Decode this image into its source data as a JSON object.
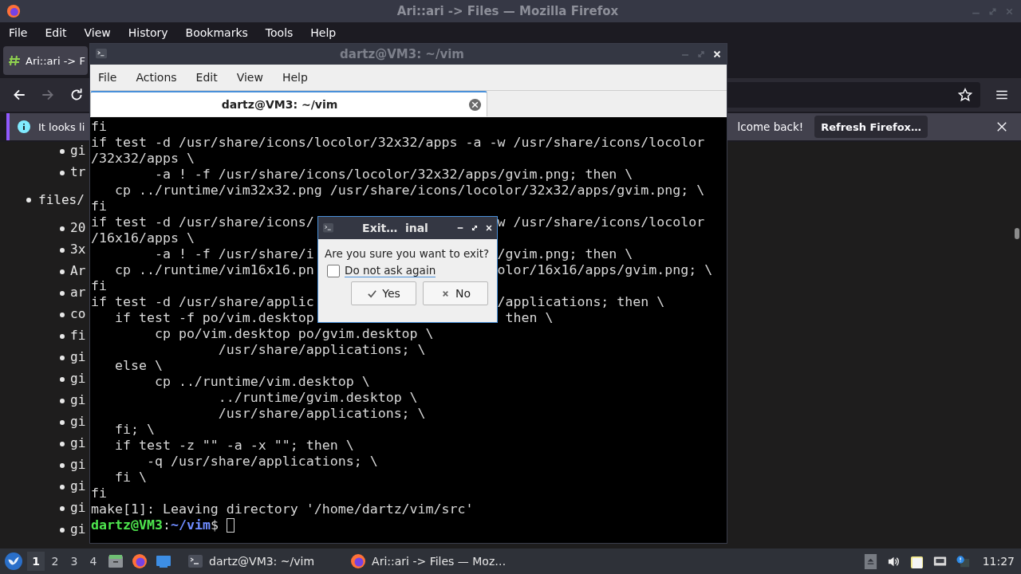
{
  "firefox": {
    "title": "Ari::ari -> Files — Mozilla Firefox",
    "menu": [
      "File",
      "Edit",
      "View",
      "History",
      "Bookmarks",
      "Tools",
      "Help"
    ],
    "tab": {
      "label": "Ari::ari -> F"
    },
    "notification": {
      "text_left": "It looks li",
      "text_right": "lcome back!",
      "button": "Refresh Firefox…"
    },
    "page_list": [
      {
        "label": "gi"
      },
      {
        "label": "tr"
      },
      {
        "label": "files/",
        "children": [
          {
            "label": "20"
          },
          {
            "label": "3x"
          },
          {
            "label": "Ar"
          },
          {
            "label": "ar"
          },
          {
            "label": "co"
          },
          {
            "label": "fi"
          },
          {
            "label": "gi"
          },
          {
            "label": "gi"
          },
          {
            "label": "gi"
          },
          {
            "label": "gi"
          },
          {
            "label": "gi"
          },
          {
            "label": "gi"
          },
          {
            "label": "gi"
          },
          {
            "label": "gi"
          },
          {
            "label": "gi"
          }
        ]
      }
    ]
  },
  "terminal": {
    "title": "dartz@VM3: ~/vim",
    "menu": [
      "File",
      "Actions",
      "Edit",
      "View",
      "Help"
    ],
    "tab": {
      "label": "dartz@VM3: ~/vim"
    },
    "lines": [
      {
        "text": "fi"
      },
      {
        "text": "if test -d /usr/share/icons/locolor/32x32/apps -a -w /usr/share/icons/locolor"
      },
      {
        "text": "/32x32/apps \\"
      },
      {
        "text": "        -a ! -f /usr/share/icons/locolor/32x32/apps/gvim.png; then \\"
      },
      {
        "text": "   cp ../runtime/vim32x32.png /usr/share/icons/locolor/32x32/apps/gvim.png; \\"
      },
      {
        "text": "fi"
      },
      {
        "text": "if test -d /usr/share/icons/",
        "after": "w /usr/share/icons/locolor"
      },
      {
        "text": "/16x16/apps \\"
      },
      {
        "text": "        -a ! -f /usr/share/i",
        "after": "/gvim.png; then \\"
      },
      {
        "text": "   cp ../runtime/vim16x16.pn",
        "after": "olor/16x16/apps/gvim.png; \\"
      },
      {
        "text": "fi"
      },
      {
        "text": "if test -d /usr/share/applic",
        "after": "/applications; then \\"
      },
      {
        "text": "   if test -f po/vim.desktop",
        "after": " then \\"
      },
      {
        "text": "        cp po/vim.desktop po/gvim.desktop \\"
      },
      {
        "text": "                /usr/share/applications; \\"
      },
      {
        "text": "   else \\"
      },
      {
        "text": "        cp ../runtime/vim.desktop \\"
      },
      {
        "text": "                ../runtime/gvim.desktop \\"
      },
      {
        "text": "                /usr/share/applications; \\"
      },
      {
        "text": "   fi; \\"
      },
      {
        "text": "   if test -z \"\" -a -x \"\"; then \\"
      },
      {
        "text": "       -q /usr/share/applications; \\"
      },
      {
        "text": "   fi \\"
      },
      {
        "text": "fi"
      },
      {
        "text": "make[1]: Leaving directory '/home/dartz/vim/src'"
      }
    ],
    "prompt": {
      "user": "dartz@VM3",
      "sep": ":",
      "path": "~/vim",
      "symbol": "$"
    }
  },
  "dialog": {
    "title": "Exit…  inal",
    "message": "Are you sure you want to exit?",
    "checkbox": {
      "label": "Do not ask again",
      "checked": false
    },
    "buttons": [
      {
        "label": "Yes",
        "kind": "confirm"
      },
      {
        "label": "No",
        "kind": "cancel"
      }
    ]
  },
  "taskbar": {
    "workspaces": [
      {
        "label": "1",
        "selected": true
      },
      {
        "label": "2",
        "selected": false
      },
      {
        "label": "3",
        "selected": false
      },
      {
        "label": "4",
        "selected": false
      }
    ],
    "tasks": [
      {
        "label": "dartz@VM3: ~/vim",
        "kind": "terminal"
      },
      {
        "label": "Ari::ari -> Files — Moz…",
        "kind": "browser"
      }
    ],
    "clock": "11:27"
  }
}
